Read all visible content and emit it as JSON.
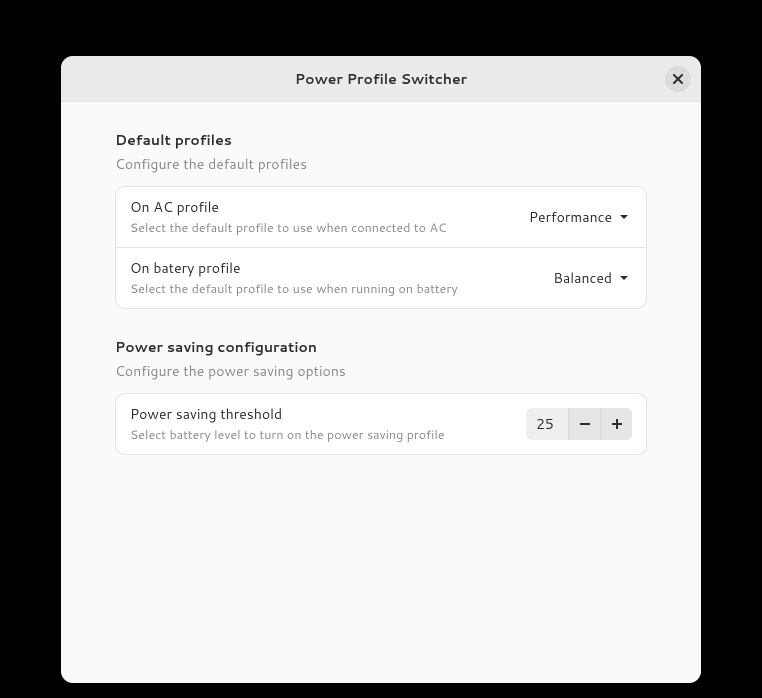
{
  "window": {
    "title": "Power Profile Switcher"
  },
  "sections": {
    "profiles": {
      "title": "Default profiles",
      "subtitle": "Configure the default profiles",
      "rows": [
        {
          "title": "On AC profile",
          "desc": "Select the default profile to use when connected to AC",
          "value": "Performance"
        },
        {
          "title": "On batery profile",
          "desc": "Select the default profile to use when running on battery",
          "value": "Balanced"
        }
      ]
    },
    "powersaving": {
      "title": "Power saving configuration",
      "subtitle": "Configure the power saving options",
      "threshold": {
        "title": "Power saving threshold",
        "desc": "Select battery level to turn on the power saving profile",
        "value": "25"
      }
    }
  }
}
